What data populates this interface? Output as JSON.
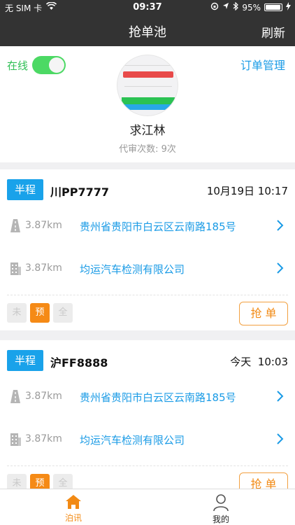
{
  "status_bar": {
    "carrier": "无 SIM 卡",
    "time": "09:37",
    "battery_text": "95%",
    "battery_level": 0.95
  },
  "nav": {
    "title": "抢单池",
    "refresh": "刷新"
  },
  "profile": {
    "online_label": "在线",
    "online_on": true,
    "order_management": "订单管理",
    "name": "求江林",
    "review_count": "代审次数: 9次"
  },
  "orders": [
    {
      "type": "半程",
      "plate": "川PP7777",
      "datetime": "10月19日 10:17",
      "rows": [
        {
          "distance": "3.87km",
          "address": "贵州省贵阳市白云区云南路185号"
        },
        {
          "distance": "3.87km",
          "address": "均运汽车检测有限公司"
        }
      ],
      "flags": [
        "未",
        "预",
        "全"
      ],
      "active_flag": "预",
      "grab": "抢 单"
    },
    {
      "type": "半程",
      "plate": "沪FF8888",
      "datetime": "今天  10:03",
      "rows": [
        {
          "distance": "3.87km",
          "address": "贵州省贵阳市白云区云南路185号"
        },
        {
          "distance": "3.87km",
          "address": "均运汽车检测有限公司"
        }
      ],
      "flags": [
        "未",
        "预",
        "全"
      ],
      "active_flag": "预",
      "grab": "抢 单"
    }
  ],
  "tabbar": {
    "items": [
      {
        "label": "泊讯",
        "icon": "home-icon",
        "active": true
      },
      {
        "label": "我的",
        "icon": "user-icon",
        "active": false
      }
    ]
  },
  "colors": {
    "nav_bg": "#333333",
    "accent_blue": "#1a9be6",
    "accent_orange": "#f28a14",
    "online_green": "#4cd964"
  }
}
